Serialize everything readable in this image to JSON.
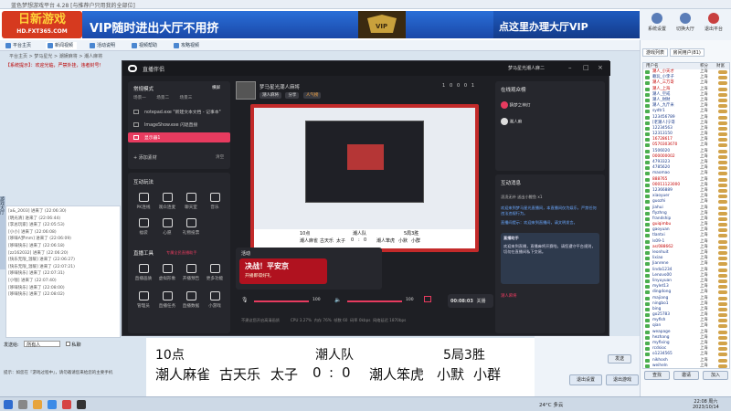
{
  "window": {
    "title": "蓝色梦想游戏平台 4.28 [与推荐户只用我的全部位]"
  },
  "banner": {
    "logo_main": "日新游戏",
    "logo_sub": "HD.FXT365.COM",
    "logo_tag": "2013 精彩无限 游戏平台",
    "vip_left": "VIP随时进出大厅不用挤",
    "vip_right": "点这里办理大厅VIP",
    "vip_badge": "VIP"
  },
  "right_tools": [
    {
      "label": "系统设置",
      "icon": "gear-icon"
    },
    {
      "label": "切换大厅",
      "icon": "swap-icon"
    },
    {
      "label": "退出平台",
      "icon": "exit-icon"
    }
  ],
  "nav": [
    {
      "label": "平台主页",
      "active": false
    },
    {
      "label": "新闻视频",
      "active": true
    },
    {
      "label": "活动说明",
      "active": false
    },
    {
      "label": "视频帮助",
      "active": false
    },
    {
      "label": "攻略视频",
      "active": false
    }
  ],
  "breadcrumb": "平台主页 > 梦马星光 > 潮娱麻将 > 潮人麻将",
  "notice": "【系统提示】：欢迎光临，严禁外挂，违者封号！",
  "side_tab": "游戏大厅",
  "left_log": [
    "[a&_2003] 进来了 (22:06:30)",
    "[明光清] 进来了 (22:06:44)",
    "[李总玩家] 进来了 (22:05:53)",
    "[小小] 进来了 (22:06:08)",
    "[哆唻A梦mm] 进来了 (22:06:09)",
    "[哆唻快乐] 进来了 (22:06:18)",
    "[zz162032] 进来了 (22:06:20)",
    "[快乐无限_温暖] 进来了 (22:06:27)",
    "[快乐无限_温暖] 进来了 (22:07:21)",
    "[哆唻快乐] 进来了 (22:07:31)",
    "[小钱] 进来了 (22:07:40)",
    "[哆唻快乐] 进来了 (22:08:00)",
    "[哆唻快乐] 进来了 (22:08:02)"
  ],
  "chat_bar": {
    "label": "发送给:",
    "target": "所有人",
    "checkbox": "私聊"
  },
  "chat_note": "提示：如您在『游戏过程中』，请勿邀请您来给您的主要手机",
  "right_panel": {
    "tabs": [
      "游戏列表",
      "房间用户(81)"
    ],
    "columns": [
      "用户名",
      "积分",
      "财富"
    ],
    "users": [
      {
        "name": "潮人_小天才",
        "region": "上海",
        "red": true
      },
      {
        "name": "赖玩_小李子",
        "region": "上海",
        "red": false
      },
      {
        "name": "潮人_三万哥",
        "region": "上海",
        "red": true
      },
      {
        "name": "潮人_上海",
        "region": "上海",
        "red": true
      },
      {
        "name": "潮人_空戒",
        "region": "上海",
        "red": false
      },
      {
        "name": "潮人_财财",
        "region": "上海",
        "red": false
      },
      {
        "name": "潮人_九斤米",
        "region": "上海",
        "red": false
      },
      {
        "name": "sydtr1",
        "region": "上海",
        "red": false
      },
      {
        "name": "123456789",
        "region": "上海",
        "red": false
      },
      {
        "name": "[老潮人]宁哥",
        "region": "上海",
        "red": false
      },
      {
        "name": "12234563",
        "region": "上海",
        "red": false
      },
      {
        "name": "12313150",
        "region": "上海",
        "red": false
      },
      {
        "name": "16728617",
        "region": "上海",
        "red": true
      },
      {
        "name": "0570303670",
        "region": "上海",
        "red": true
      },
      {
        "name": "1506020",
        "region": "上海",
        "red": false
      },
      {
        "name": "000000002",
        "region": "上海",
        "red": true
      },
      {
        "name": "4793323",
        "region": "上海",
        "red": false
      },
      {
        "name": "4785620",
        "region": "上海",
        "red": false
      },
      {
        "name": "maomao",
        "region": "上海",
        "red": false
      },
      {
        "name": "888765",
        "region": "上海",
        "red": true
      },
      {
        "name": "00011123000",
        "region": "上海",
        "red": true
      },
      {
        "name": "12366889",
        "region": "上海",
        "red": false
      },
      {
        "name": "xiaoyuer",
        "region": "上海",
        "red": false
      },
      {
        "name": "guozhi",
        "region": "上海",
        "red": false
      },
      {
        "name": "jiahui",
        "region": "上海",
        "red": false
      },
      {
        "name": "flyzhng",
        "region": "上海",
        "red": false
      },
      {
        "name": "frandship",
        "region": "上海",
        "red": false
      },
      {
        "name": "guiqimbu",
        "region": "上海",
        "red": true
      },
      {
        "name": "gaoyuan",
        "region": "上海",
        "red": false
      },
      {
        "name": "tlantxi",
        "region": "上海",
        "red": false
      },
      {
        "name": "ls09-1",
        "region": "上海",
        "red": false
      },
      {
        "name": "as/088662",
        "region": "上海",
        "red": true
      },
      {
        "name": "leonhuit",
        "region": "上海",
        "red": false
      },
      {
        "name": "lixiao",
        "region": "上海",
        "red": false
      },
      {
        "name": "Jianrene",
        "region": "上海",
        "red": false
      },
      {
        "name": "linda1234",
        "region": "上海",
        "red": false
      },
      {
        "name": "Lenovo00",
        "region": "上海",
        "red": false
      },
      {
        "name": "linyuyuan",
        "region": "上海",
        "red": false
      },
      {
        "name": "mylet13",
        "region": "上海",
        "red": false
      },
      {
        "name": "dingdong",
        "region": "上海",
        "red": false
      },
      {
        "name": "majiang",
        "region": "上海",
        "red": false
      },
      {
        "name": "ningbo1",
        "region": "上海",
        "red": false
      },
      {
        "name": "bing",
        "region": "上海",
        "red": false
      },
      {
        "name": "go25783",
        "region": "上海",
        "red": false
      },
      {
        "name": "myfish",
        "region": "上海",
        "red": false
      },
      {
        "name": "qian",
        "region": "上海",
        "red": false
      },
      {
        "name": "weapage",
        "region": "上海",
        "red": false
      },
      {
        "name": "hezhang",
        "region": "上海",
        "red": false
      },
      {
        "name": "myfixing",
        "region": "上海",
        "red": false
      },
      {
        "name": "rcdsioc",
        "region": "上海",
        "red": false
      },
      {
        "name": "o1234565",
        "region": "上海",
        "red": false
      },
      {
        "name": "nikhosh",
        "region": "上海",
        "red": false
      },
      {
        "name": "weiheln",
        "region": "上海",
        "red": false
      },
      {
        "name": "szhou",
        "region": "上海",
        "red": false
      }
    ],
    "buttons": [
      "查找",
      "邀请",
      "加入"
    ],
    "bottom_buttons": [
      "退出设置",
      "退出游戏"
    ]
  },
  "send": {
    "label": "发送"
  },
  "obs": {
    "title": "直播伴侣",
    "user_tab": "梦马星光潮人麻二",
    "left": {
      "mode_label": "常规模式",
      "mode_switch": "横屏",
      "scene_tabs": [
        "场景一",
        "场景二",
        "场景三"
      ],
      "scenes": [
        "notepad.exe \"新建文本文档 - 记事本\"",
        "ImageShow.exe 闪退直接",
        "显示器1"
      ],
      "add_material": "+ 添加素材",
      "clear": "清空",
      "interact_title": "互动玩法",
      "interact": [
        "PK连线",
        "观众连麦",
        "聊天室",
        "音乐",
        "福袋",
        "心愿",
        "礼物投票"
      ],
      "tools_title": "直播工具",
      "tools_hint": "专属全民直播助手",
      "tools": [
        "直播画质",
        "虚拟形象",
        "开播预告",
        "更多功能",
        "管理员",
        "直播任务",
        "直播数据",
        "小游戏"
      ]
    },
    "stream": {
      "name": "梦马星光潮人麻将",
      "tags": [
        "潮人麻将",
        "分享",
        "人气榜"
      ],
      "counts": [
        "1",
        "0",
        "0",
        "0",
        "1"
      ]
    },
    "preview_caption": {
      "row1": [
        "10点",
        "潮人队",
        "5局3胜"
      ],
      "row2": [
        "潮人麻雀",
        "古天乐",
        "太子",
        "0",
        ":",
        "0",
        "潮人笨虎",
        "小默",
        "小群"
      ]
    },
    "activity": {
      "title": "活动",
      "banner_title": "决战！平安京",
      "banner_sub": "开播即得好礼"
    },
    "audio": {
      "mic": "100",
      "speaker": "100"
    },
    "start": {
      "time": "00:08:03",
      "label": "关播"
    },
    "status": {
      "hint": "不建议您开启高清画质",
      "cpu": "CPU 3.27%",
      "mem": "内存 76%",
      "fps": "帧数 60",
      "bitrate": "码率 0kbps",
      "net": "网络延迟 1870bps"
    },
    "right": {
      "viewers_title": "在线观众榜",
      "viewers": [
        "猜梦之神灯",
        "潮人麻"
      ],
      "interact_title": "互动消息",
      "messages": [
        "凌凌无补 送出小鲤鱼 x1",
        "欢迎来到梦马星光直播间，本直播间仅为娱乐，严禁任何违法违规行为。",
        "直播间提示：欢迎来到直播间，请文明发言。"
      ],
      "assistant": "直播助手",
      "assistant_msg": "欢迎来到直播，直播麻将开赛啦，请您遵守平台规则，切勿在直播间私下交易。",
      "footer": "潮人麻将"
    }
  },
  "score_overlay": {
    "row1": [
      "10点",
      "潮人队",
      "5局3胜"
    ],
    "row2": [
      "潮人麻雀",
      "古天乐",
      "太子",
      "0",
      ":",
      "0",
      "潮人笨虎",
      "小默",
      "小群"
    ]
  },
  "taskbar": {
    "weather": "24°C 多云",
    "time": "22:08 周六",
    "date": "2023/10/14"
  }
}
